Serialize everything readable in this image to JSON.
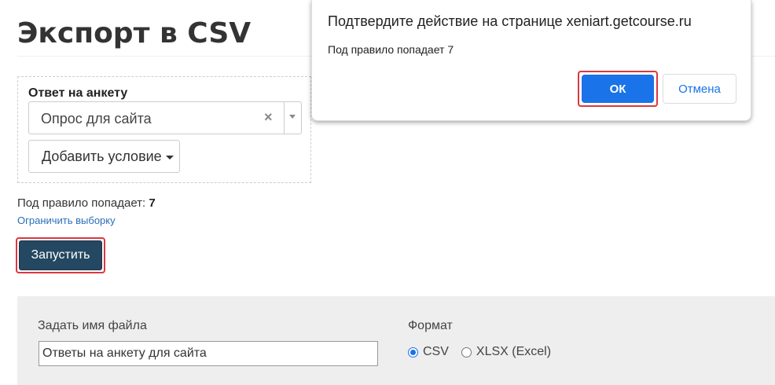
{
  "page": {
    "title": "Экспорт в CSV"
  },
  "condition": {
    "label": "Ответ на анкету",
    "selected_value": "Опрос для сайта",
    "clear_symbol": "×",
    "add_condition_label": "Добавить условие"
  },
  "rule_summary": {
    "text": "Под правило попадает:",
    "count": "7",
    "limit_link": "Ограничить выборку"
  },
  "run_button_label": "Запустить",
  "file_settings": {
    "filename_label": "Задать имя файла",
    "filename_value": "Ответы на анкету для сайта",
    "format_label": "Формат",
    "formats": [
      {
        "label": "CSV",
        "checked": true
      },
      {
        "label": "XLSX (Excel)",
        "checked": false
      }
    ]
  },
  "dialog": {
    "title": "Подтвердите действие на странице xeniart.getcourse.ru",
    "message": "Под правило попадает 7",
    "ok_label": "ОК",
    "cancel_label": "Отмена"
  },
  "colors": {
    "run_button": "#254862",
    "dialog_primary": "#1a73e8",
    "highlight": "#d9383f",
    "link": "#2a6ebb"
  }
}
